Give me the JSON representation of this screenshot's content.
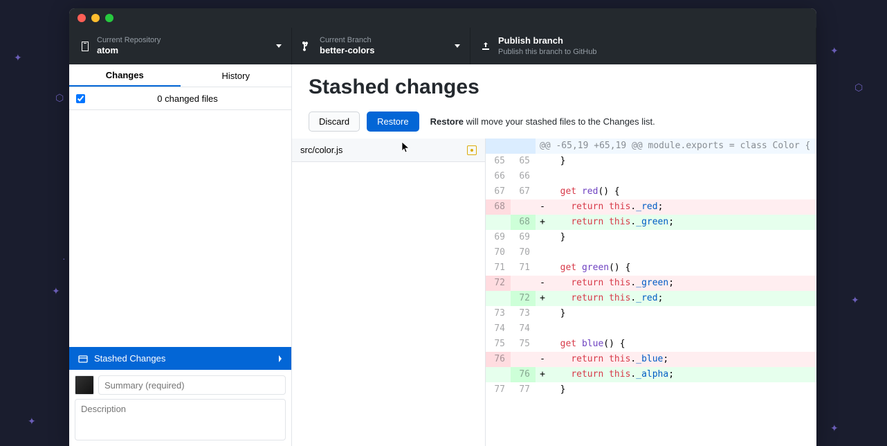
{
  "titlebar": {},
  "toolbar": {
    "repo": {
      "label": "Current Repository",
      "value": "atom"
    },
    "branch": {
      "label": "Current Branch",
      "value": "better-colors"
    },
    "publish": {
      "label": "Publish branch",
      "sub": "Publish this branch to GitHub"
    }
  },
  "sidebar": {
    "tabs": {
      "changes": "Changes",
      "history": "History"
    },
    "changed_files_label": "0 changed files",
    "stashed_label": "Stashed Changes",
    "summary_placeholder": "Summary (required)",
    "desc_placeholder": "Description"
  },
  "main": {
    "title": "Stashed changes",
    "discard": "Discard",
    "restore": "Restore",
    "restore_bold": "Restore",
    "restore_desc": " will move your stashed files to the Changes list."
  },
  "file": {
    "path": "src/color.js"
  },
  "diff": {
    "hunk": "@@ -65,19 +65,19 @@ module.exports = class Color {",
    "lines": [
      {
        "oldNum": "65",
        "newNum": "65",
        "type": "ctx",
        "marker": " ",
        "text": "  }"
      },
      {
        "oldNum": "66",
        "newNum": "66",
        "type": "ctx",
        "marker": " ",
        "text": ""
      },
      {
        "oldNum": "67",
        "newNum": "67",
        "type": "ctx",
        "marker": " ",
        "text": "  get red() {"
      },
      {
        "oldNum": "68",
        "newNum": "",
        "type": "del",
        "marker": "-",
        "text": "    return this._red;"
      },
      {
        "oldNum": "",
        "newNum": "68",
        "type": "add",
        "marker": "+",
        "text": "    return this._green;"
      },
      {
        "oldNum": "69",
        "newNum": "69",
        "type": "ctx",
        "marker": " ",
        "text": "  }"
      },
      {
        "oldNum": "70",
        "newNum": "70",
        "type": "ctx",
        "marker": " ",
        "text": ""
      },
      {
        "oldNum": "71",
        "newNum": "71",
        "type": "ctx",
        "marker": " ",
        "text": "  get green() {"
      },
      {
        "oldNum": "72",
        "newNum": "",
        "type": "del",
        "marker": "-",
        "text": "    return this._green;"
      },
      {
        "oldNum": "",
        "newNum": "72",
        "type": "add",
        "marker": "+",
        "text": "    return this._red;"
      },
      {
        "oldNum": "73",
        "newNum": "73",
        "type": "ctx",
        "marker": " ",
        "text": "  }"
      },
      {
        "oldNum": "74",
        "newNum": "74",
        "type": "ctx",
        "marker": " ",
        "text": ""
      },
      {
        "oldNum": "75",
        "newNum": "75",
        "type": "ctx",
        "marker": " ",
        "text": "  get blue() {"
      },
      {
        "oldNum": "76",
        "newNum": "",
        "type": "del",
        "marker": "-",
        "text": "    return this._blue;"
      },
      {
        "oldNum": "",
        "newNum": "76",
        "type": "add",
        "marker": "+",
        "text": "    return this._alpha;"
      },
      {
        "oldNum": "77",
        "newNum": "77",
        "type": "ctx",
        "marker": " ",
        "text": "  }"
      }
    ]
  }
}
